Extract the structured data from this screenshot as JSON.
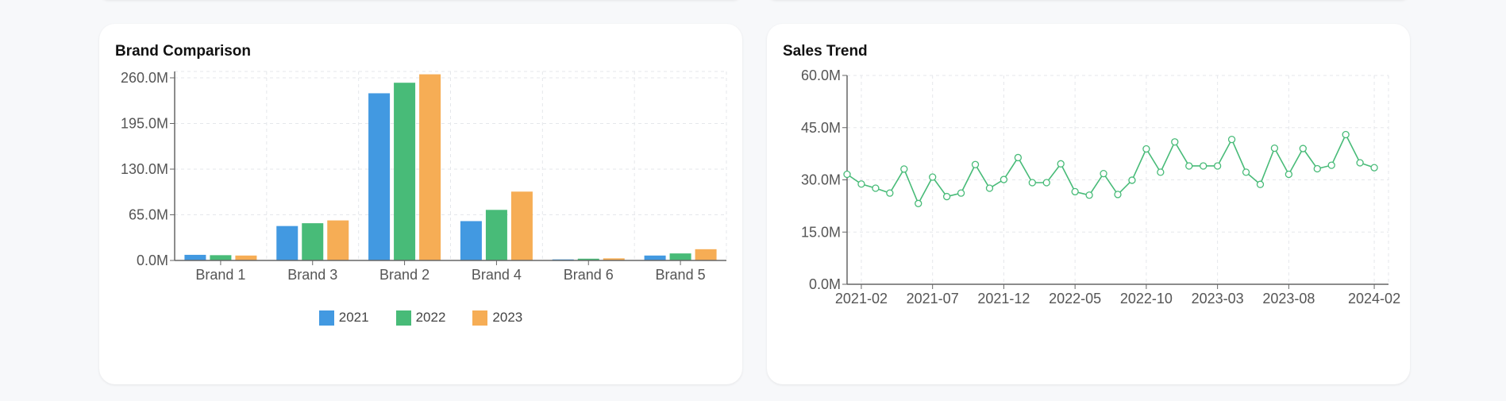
{
  "colors": {
    "y2021": "#4299e1",
    "y2022": "#48bb78",
    "y2023": "#f6ad55",
    "trend": "#48bb78",
    "grid": "#e5e7eb",
    "axis": "#666666",
    "tick_text": "#555555"
  },
  "brand_card": {
    "title": "Brand Comparison"
  },
  "trend_card": {
    "title": "Sales Trend"
  },
  "chart_data": [
    {
      "type": "bar",
      "title": "Brand Comparison",
      "categories": [
        "Brand 1",
        "Brand 3",
        "Brand 2",
        "Brand 4",
        "Brand 6",
        "Brand 5"
      ],
      "series": [
        {
          "name": "2021",
          "values": [
            8,
            49,
            238,
            56,
            1.5,
            7
          ]
        },
        {
          "name": "2022",
          "values": [
            7.5,
            53,
            253,
            72,
            2.5,
            10
          ]
        },
        {
          "name": "2023",
          "values": [
            7,
            57,
            265,
            98,
            3,
            16
          ]
        }
      ],
      "ylim": [
        0,
        260
      ],
      "yticks": [
        "0.0M",
        "65.0M",
        "130.0M",
        "195.0M",
        "260.0M"
      ],
      "legend": "bottom-center",
      "grid": true
    },
    {
      "type": "line",
      "title": "Sales Trend",
      "x": [
        "2021-01",
        "2021-02",
        "2021-03",
        "2021-04",
        "2021-05",
        "2021-06",
        "2021-07",
        "2021-08",
        "2021-09",
        "2021-10",
        "2021-11",
        "2021-12",
        "2022-01",
        "2022-02",
        "2022-03",
        "2022-04",
        "2022-05",
        "2022-06",
        "2022-07",
        "2022-08",
        "2022-09",
        "2022-10",
        "2022-11",
        "2022-12",
        "2023-01",
        "2023-02",
        "2023-03",
        "2023-04",
        "2023-05",
        "2023-06",
        "2023-07",
        "2023-08",
        "2023-09",
        "2023-10",
        "2023-11",
        "2023-12",
        "2024-01",
        "2024-02",
        "2024-03"
      ],
      "values": [
        31.6,
        28.8,
        27.6,
        26.2,
        33.1,
        23.2,
        30.8,
        25.2,
        26.2,
        34.4,
        27.6,
        30.1,
        36.4,
        29.2,
        29.2,
        34.6,
        26.6,
        25.6,
        31.8,
        25.8,
        29.9,
        38.9,
        32.2,
        40.9,
        34.0,
        34.0,
        34.0,
        41.6,
        32.2,
        28.7,
        39.1,
        31.6,
        39.0,
        33.2,
        34.2,
        43.0,
        34.9,
        33.5
      ],
      "xticks": [
        "2021-02",
        "2021-07",
        "2021-12",
        "2022-05",
        "2022-10",
        "2023-03",
        "2023-08",
        "2024-02"
      ],
      "ylim": [
        0,
        60
      ],
      "yticks": [
        "0.0M",
        "15.0M",
        "30.0M",
        "45.0M",
        "60.0M"
      ],
      "grid": true
    }
  ]
}
